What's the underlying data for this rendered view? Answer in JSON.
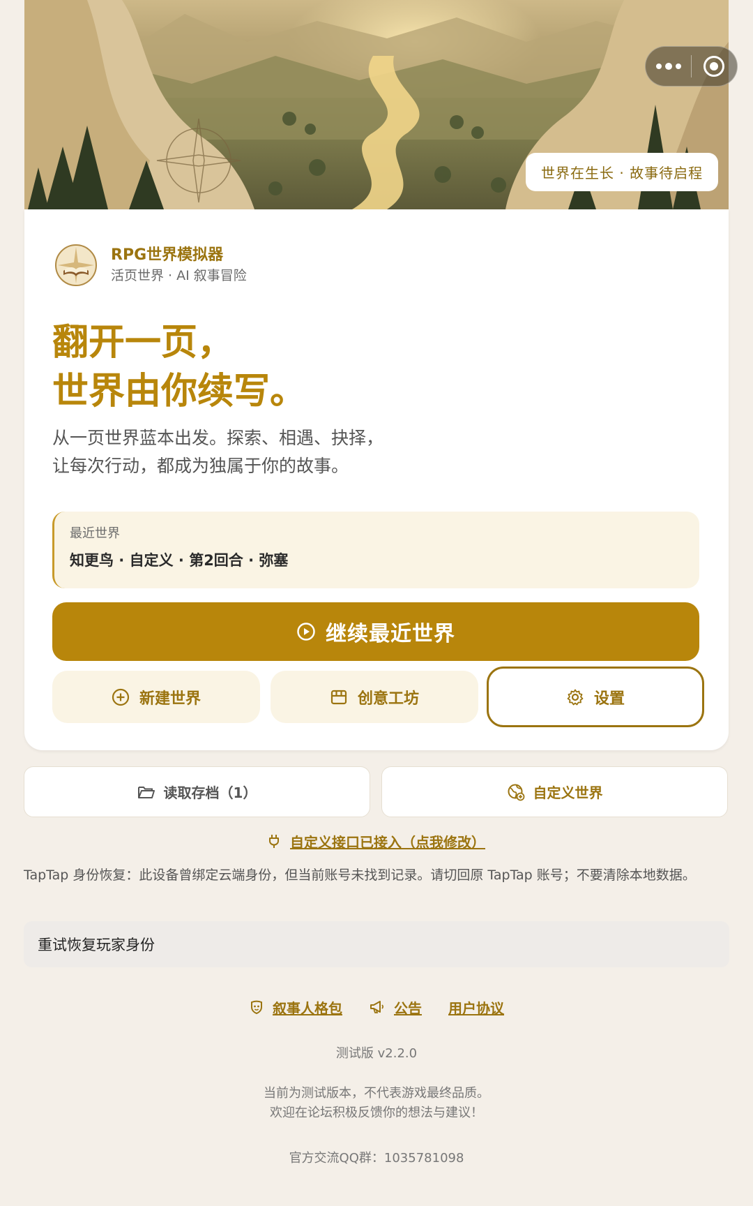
{
  "hero": {
    "badge": "世界在生长 · 故事待启程"
  },
  "brand": {
    "name": "RPG世界模拟器",
    "subtitle": "活页世界 · AI 叙事冒险"
  },
  "headline": {
    "line1": "翻开一页，",
    "line2": "世界由你续写。"
  },
  "intro": {
    "line1": "从一页世界蓝本出发。探索、相遇、抉择，",
    "line2": "让每次行动，都成为独属于你的故事。"
  },
  "recent": {
    "label": "最近世界",
    "value": "知更鸟 · 自定义 · 第2回合 · 弥塞"
  },
  "buttons": {
    "continue": "继续最近世界",
    "new_world": "新建世界",
    "workshop": "创意工坊",
    "settings": "设置",
    "load_save": "读取存档（1）",
    "custom_world": "自定义世界",
    "api_link": "自定义接口已接入（点我修改）",
    "retry": "重试恢复玩家身份"
  },
  "notice": "TapTap 身份恢复：此设备曾绑定云端身份，但当前账号未找到记录。请切回原 TapTap 账号；不要清除本地数据。",
  "footer": {
    "links": [
      "叙事人格包",
      "公告",
      "用户协议"
    ],
    "version": "测试版 v2.2.0",
    "disclaimer_line1": "当前为测试版本，不代表游戏最终品质。",
    "disclaimer_line2": "欢迎在论坛积极反馈你的想法与建议！",
    "qq": "官方交流QQ群：1035781098"
  },
  "colors": {
    "accent": "#b8860b",
    "accent_dark": "#9b7410",
    "background": "#f4efe8",
    "soft": "#faf4e4"
  },
  "icons": [
    "more-dots-icon",
    "record-target-icon",
    "play-circle-icon",
    "plus-circle-icon",
    "storefront-icon",
    "gear-icon",
    "folder-open-icon",
    "globe-add-icon",
    "plug-icon",
    "mask-icon",
    "megaphone-icon"
  ]
}
